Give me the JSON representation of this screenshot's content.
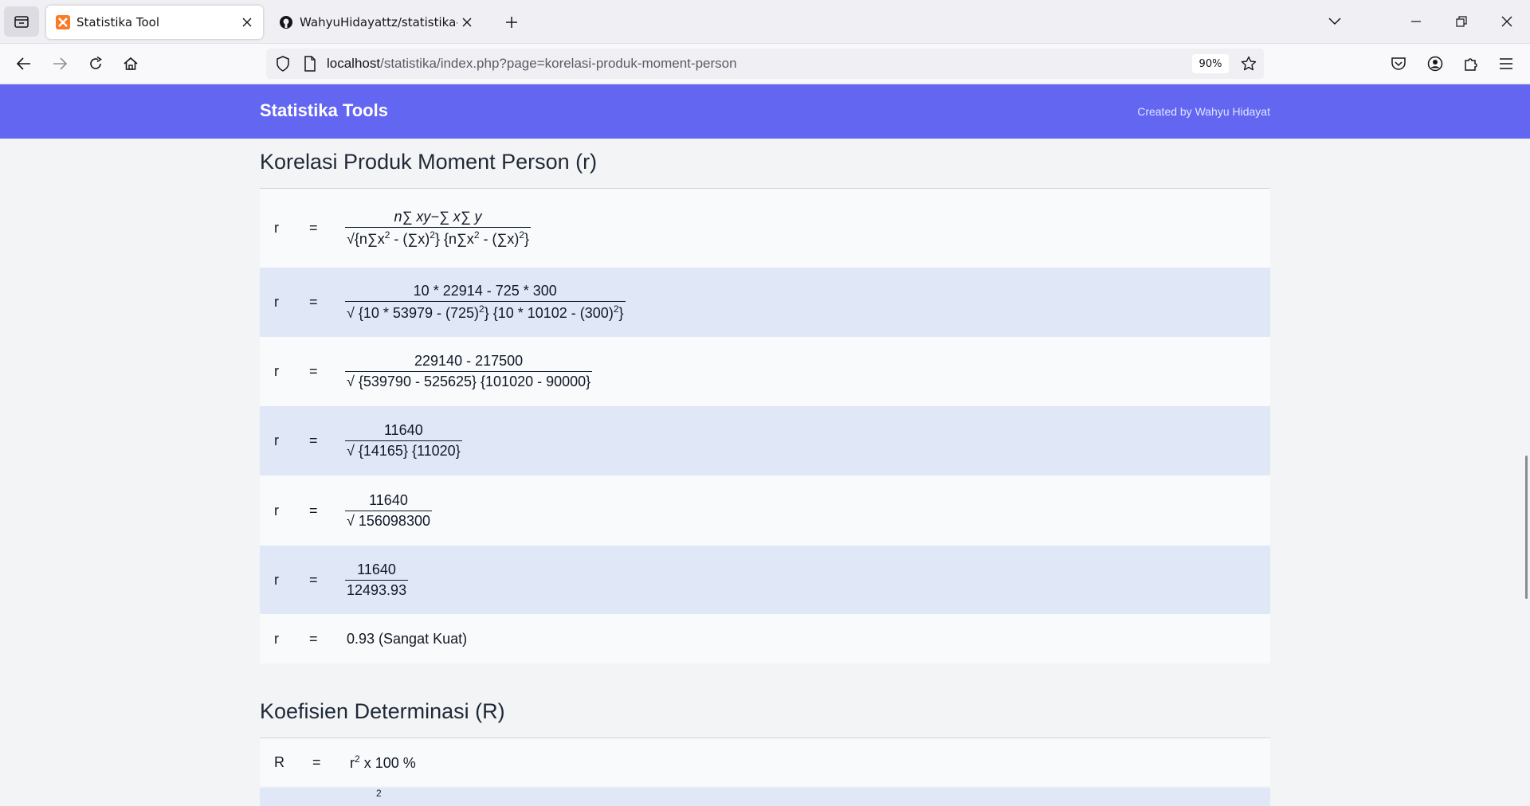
{
  "browser": {
    "tabs": [
      {
        "title": "Statistika Tool",
        "active": true,
        "icon": "xampp-favicon-icon"
      },
      {
        "title": "WahyuHidayattz/statistika-tools",
        "active": false,
        "icon": "github-icon"
      }
    ],
    "url": {
      "host": "localhost",
      "path": "/statistika/index.php?page=korelasi-produk-moment-person"
    },
    "zoom": "90%"
  },
  "header": {
    "brand": "Statistika Tools",
    "credit": "Created by Wahyu Hidayat"
  },
  "korelasi": {
    "title": "Korelasi Produk Moment Person (r)",
    "lhs": "r",
    "eq": "=",
    "step2": {
      "num": "10 * 22914 - 725 * 300",
      "den_a": "√ {10 * 53979 - (725)",
      "den_b": "} {10 * 10102 - (300)",
      "den_c": "}"
    },
    "step3": {
      "num": "229140 - 217500",
      "den": "√ {539790 - 525625} {101020 - 90000}"
    },
    "step4": {
      "num": "11640",
      "den": "√ {14165} {11020}"
    },
    "step5": {
      "num": "11640",
      "den": "√ 156098300"
    },
    "step6": {
      "num": "11640",
      "den": "12493.93"
    },
    "result": "0.93 (Sangat Kuat)"
  },
  "determinasi": {
    "title": "Koefisien Determinasi (R)",
    "lhs": "R",
    "eq": "=",
    "formula_tail": " x 100 %"
  }
}
